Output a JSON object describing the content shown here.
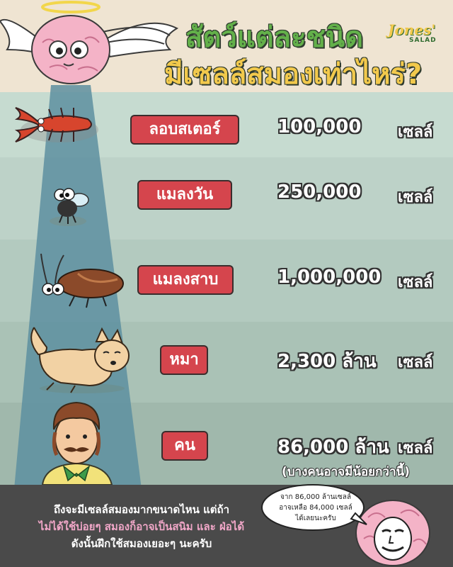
{
  "header": {
    "title_line1": "สัตว์แต่ละชนิด",
    "title_line2": "มีเซลล์สมองเท่าไหร่?",
    "logo_brand": "Jones'",
    "logo_sub": "SALAD"
  },
  "rows": [
    {
      "label": "ลอบสเตอร์",
      "value": "100,000",
      "unit": "เซลล์",
      "icon": "lobster-icon"
    },
    {
      "label": "แมลงวัน",
      "value": "250,000",
      "unit": "เซลล์",
      "icon": "fly-icon"
    },
    {
      "label": "แมลงสาบ",
      "value": "1,000,000",
      "unit": "เซลล์",
      "icon": "cockroach-icon"
    },
    {
      "label": "หมา",
      "value": "2,300 ล้าน",
      "unit": "เซลล์",
      "icon": "dog-icon"
    },
    {
      "label": "คน",
      "value": "86,000 ล้าน",
      "unit": "เซลล์",
      "icon": "man-icon"
    }
  ],
  "human_note": "(บางคนอาจมีน้อยกว่านี้)",
  "footer": {
    "line1": "ถึงจะมีเซลล์สมองมากขนาดไหน แต่ถ้า",
    "line2": "ไม่ได้ใช้บ่อยๆ สมองก็อาจเป็นสนิม และ ฝ่อได้",
    "line3": "ดังนั้นฝึกใช้สมองเยอะๆ นะครับ"
  },
  "bubble": {
    "line1": "จาก 86,000 ล้านเซลล์",
    "line2": "อาจเหลือ 84,000 เซลล์",
    "line3": "ได้เลยนะครับ"
  },
  "colors": {
    "label_red": "#d5454d",
    "title_green": "#63b04a",
    "title_yellow": "#f2c94c",
    "footer_bg": "#4a4a4a",
    "pink_text": "#f1a7c8"
  }
}
